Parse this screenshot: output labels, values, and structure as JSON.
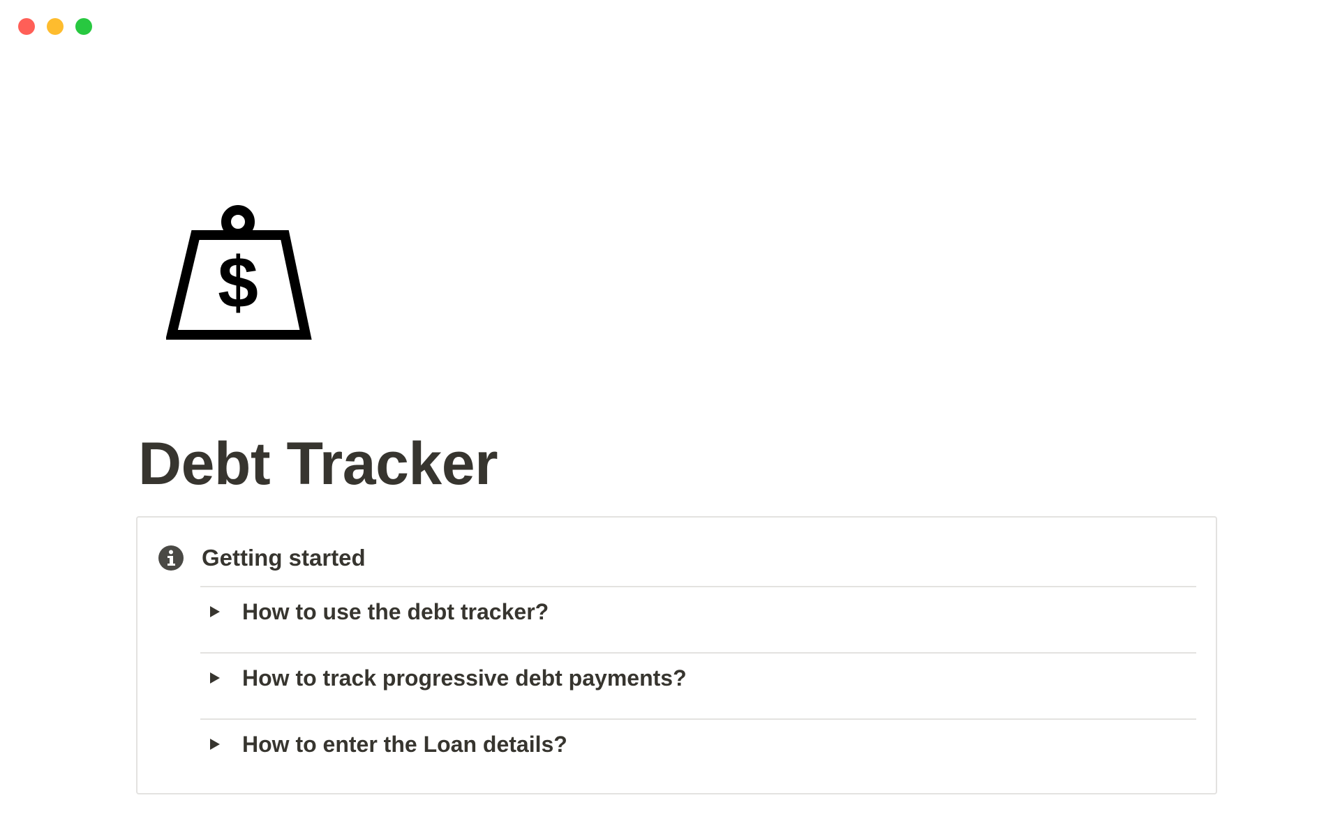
{
  "window": {
    "controls": [
      "close",
      "minimize",
      "maximize"
    ]
  },
  "page": {
    "icon": "money-weight-icon",
    "title": "Debt Tracker"
  },
  "callout": {
    "icon": "info-icon",
    "heading": "Getting started",
    "toggles": [
      {
        "label": "How to use the debt tracker?"
      },
      {
        "label": "How to track progressive debt payments?"
      },
      {
        "label": "How to enter the Loan details?"
      }
    ]
  },
  "colors": {
    "text": "#37352f",
    "border": "#e3e2e0",
    "close": "#ff5f57",
    "minimize": "#febc2e",
    "maximize": "#28c840"
  }
}
